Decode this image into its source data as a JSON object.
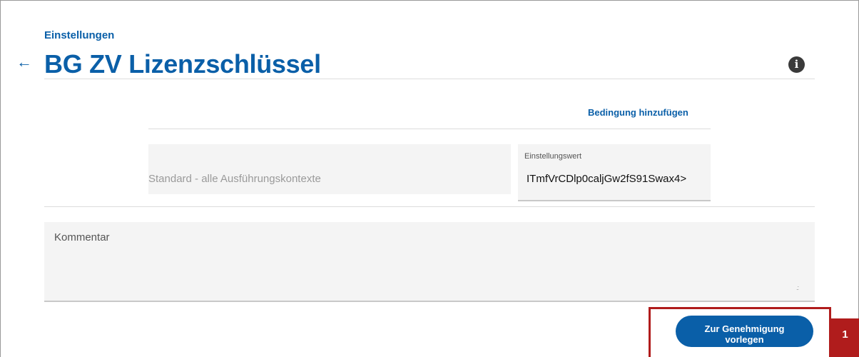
{
  "header": {
    "breadcrumb": "Einstellungen",
    "back_icon": "←",
    "title": "BG ZV Lizenzschlüssel",
    "info_icon": "i"
  },
  "conditions": {
    "add_link": "Bedingung hinzufügen",
    "context_text": "Standard - alle Ausführungskontexte",
    "value_label": "Einstellungswert",
    "value": "ITmfVrCDlp0caljGw2fS91Swax4>"
  },
  "comment": {
    "placeholder": "Kommentar",
    "grip": ".:"
  },
  "actions": {
    "submit_line1": "Zur Genehmigung",
    "submit_line2": "vorlegen"
  },
  "annotation": {
    "marker": "1",
    "color": "#b01c1c"
  },
  "colors": {
    "brand_blue": "#0a5fa8"
  }
}
